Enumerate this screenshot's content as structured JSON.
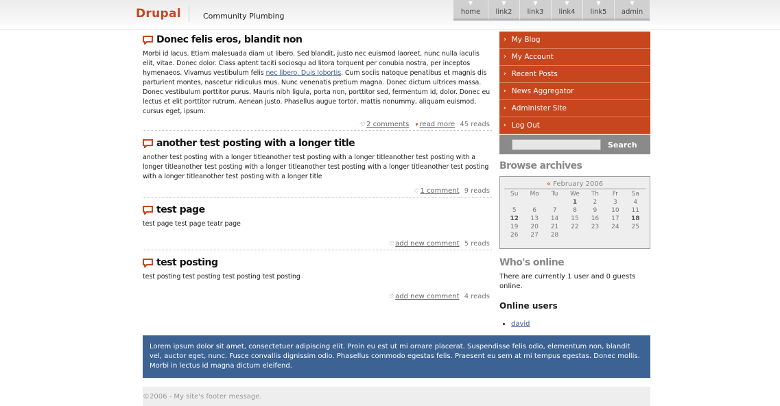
{
  "header": {
    "logo": "Drupal",
    "slogan": "Community Plumbing",
    "nav": [
      "home",
      "link2",
      "link3",
      "link4",
      "link5",
      "admin"
    ]
  },
  "posts": [
    {
      "title": "Donec felis eros, blandit non",
      "body_before_link": "Morbi id lacus. Etiam malesuada diam ut libero. Sed blandit, justo nec euismod laoreet, nunc nulla iaculis elit, vitae. Donec dolor. Class aptent taciti sociosqu ad litora torquent per conubia nostra, per inceptos hymenaeos. Vivamus vestibulum felis ",
      "body_link": "nec libero. Duis lobortis",
      "body_after_link": ". Cum sociis natoque penatibus et magnis dis parturient montes, nascetur ridiculus mus. Nunc venenatis pretium magna. Donec dictum ultrices massa. Donec vestibulum porttitor purus. Mauris nibh ligula, porta non, porttitor sed, fermentum id, dolor. Donec eu lectus et elit porttitor rutrum. Aenean justo. Phasellus augue tortor, mattis nonummy, aliquam euismod, cursus eget, ipsum.",
      "comments": "2 comments",
      "read_more": "read more",
      "reads": "45 reads"
    },
    {
      "title": "another test posting with a longer title",
      "body": "another test posting with a longer titleanother test posting with a longer titleanother test posting with a longer titleanother test posting with a longer titleanother test posting with a longer titleanother test posting with a longer titleanother test posting with a longer title",
      "comments": "1 comment",
      "reads": "9 reads"
    },
    {
      "title": "test page",
      "body": "test page test page teatr page",
      "comments": "add new comment",
      "reads": "5 reads"
    },
    {
      "title": "test posting",
      "body": "test posting test posting test posting test posting",
      "comments": "add new comment",
      "reads": "4 reads"
    }
  ],
  "sidebar": {
    "menu": [
      "My Blog",
      "My Account",
      "Recent Posts",
      "News Aggregator",
      "Administer Site",
      "Log Out"
    ],
    "search_button": "Search",
    "archives_title": "Browse archives",
    "calendar": {
      "prev": "«",
      "month": "February 2006",
      "weekdays": [
        "Su",
        "Mo",
        "Tu",
        "We",
        "Th",
        "Fr",
        "Sa"
      ],
      "leading_blanks": 3,
      "days": 28,
      "bold_days": [
        1,
        12,
        18
      ]
    },
    "whos_online_title": "Who's online",
    "whos_online_text": "There are currently 1 user and 0 guests online.",
    "online_users_title": "Online users",
    "online_users": [
      "david"
    ]
  },
  "mission": "Lorem ipsum dolor sit amet, consectetuer adipiscing elit. Proin eu est ut mi ornare placerat. Suspendisse felis odio, elementum non, blandit vel, auctor eget, nunc. Fusce convallis dignissim odio. Phasellus commodo egestas felis. Praesent eu sem at mi tempus egestas. Donec mollis. Morbi in lectus id magna dictum eleifend.",
  "footer": "©2006 - My site's footer message.",
  "colors": {
    "accent": "#c7461e",
    "mission_bg": "#3c6394",
    "nav_bg": "#d0d0d0"
  }
}
